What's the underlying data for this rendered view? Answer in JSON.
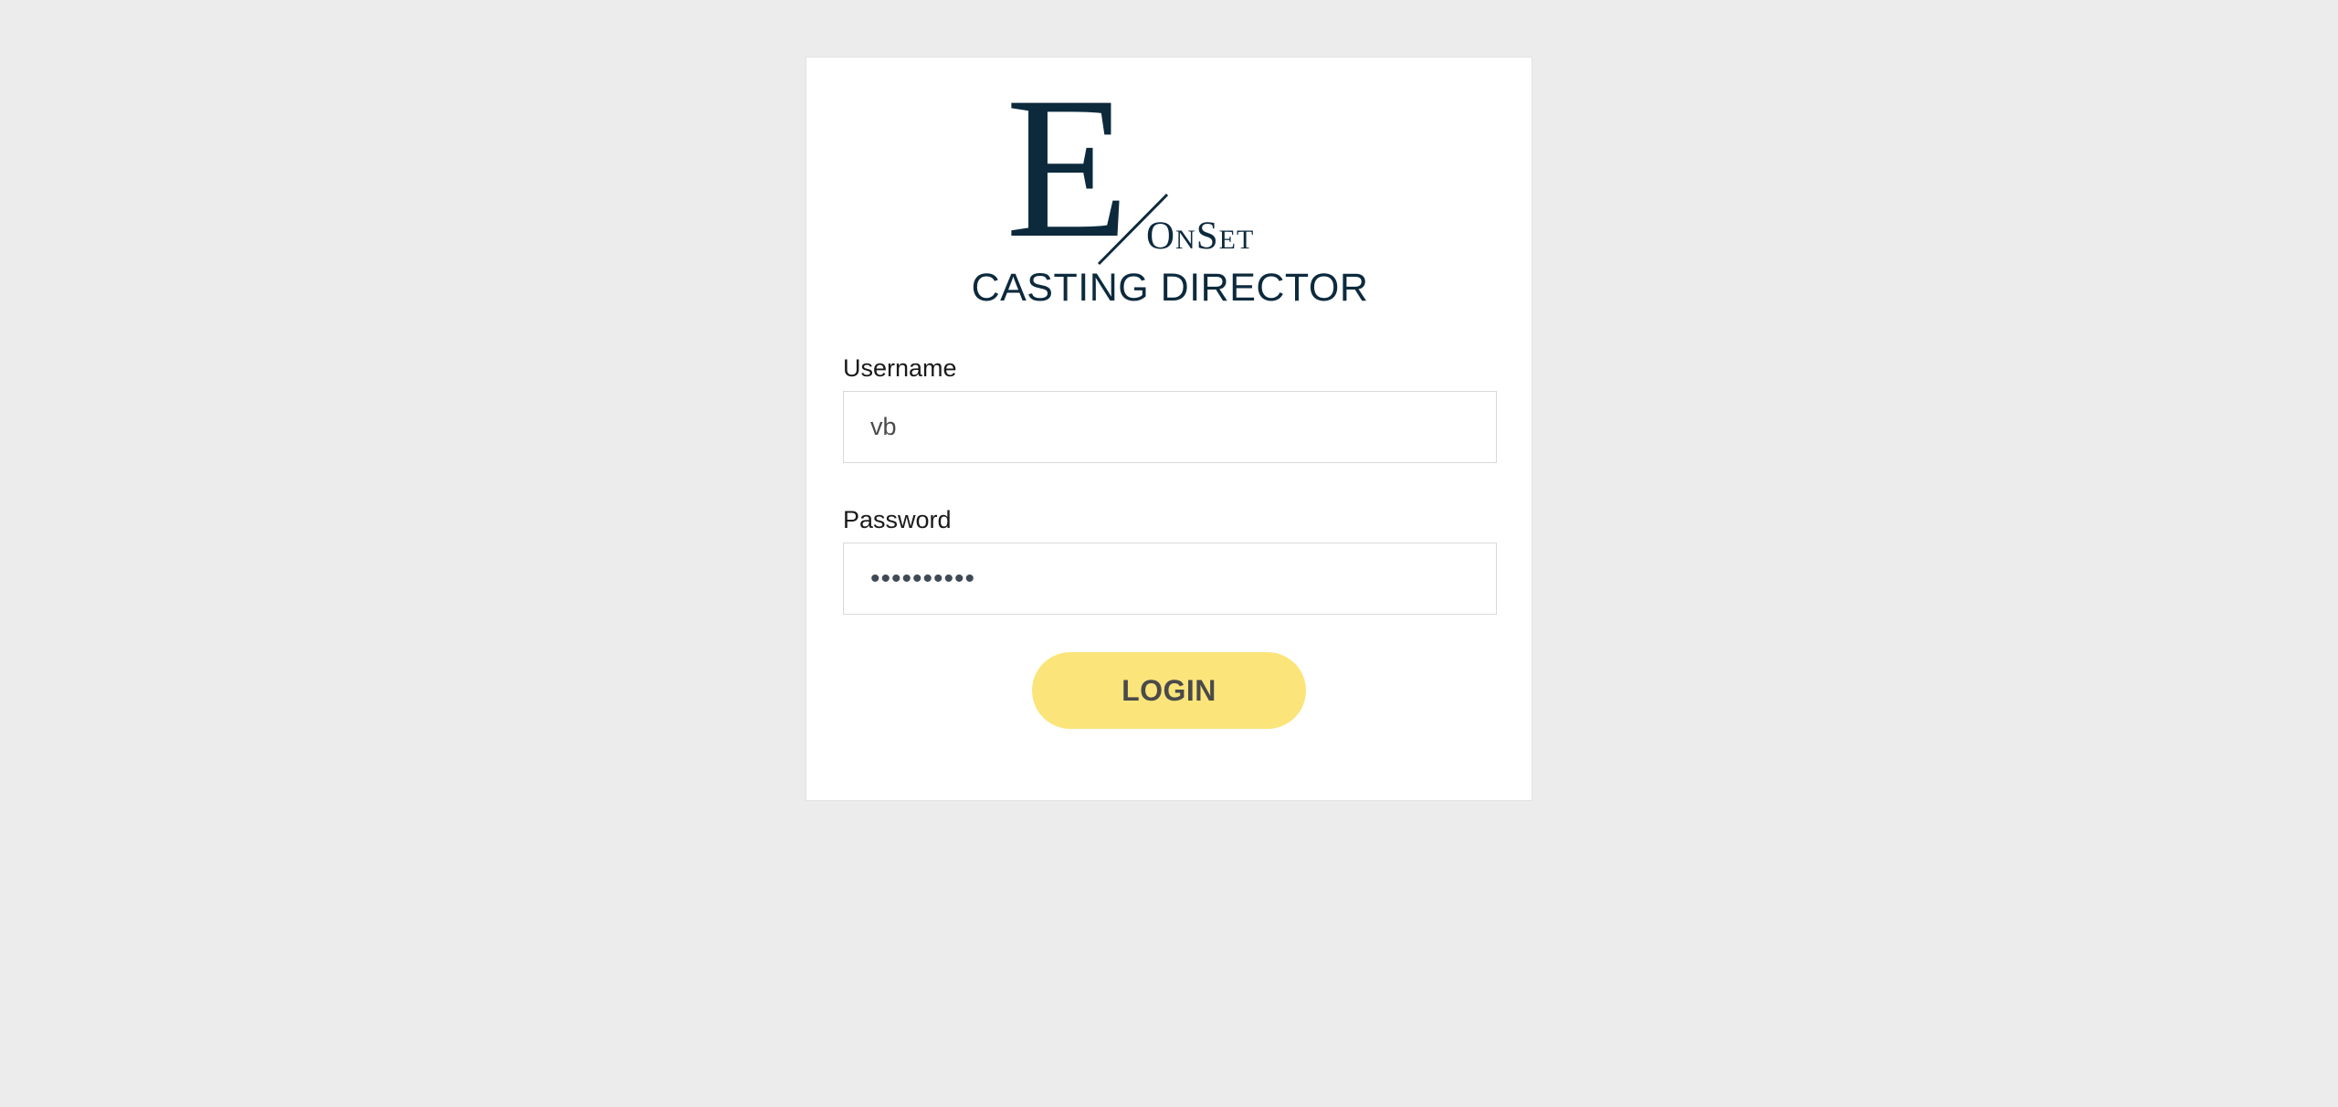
{
  "logo": {
    "letter": "E",
    "wordmark": "OnSet",
    "subtitle": "CASTING DIRECTOR",
    "color": "#0d2a3d"
  },
  "form": {
    "username": {
      "label": "Username",
      "value": "vb"
    },
    "password": {
      "label": "Password",
      "value": "••••••••••"
    },
    "login_label": "LOGIN"
  },
  "colors": {
    "background": "#ececec",
    "card": "#ffffff",
    "button": "#fbe57a",
    "button_text": "#4a4a4a"
  }
}
